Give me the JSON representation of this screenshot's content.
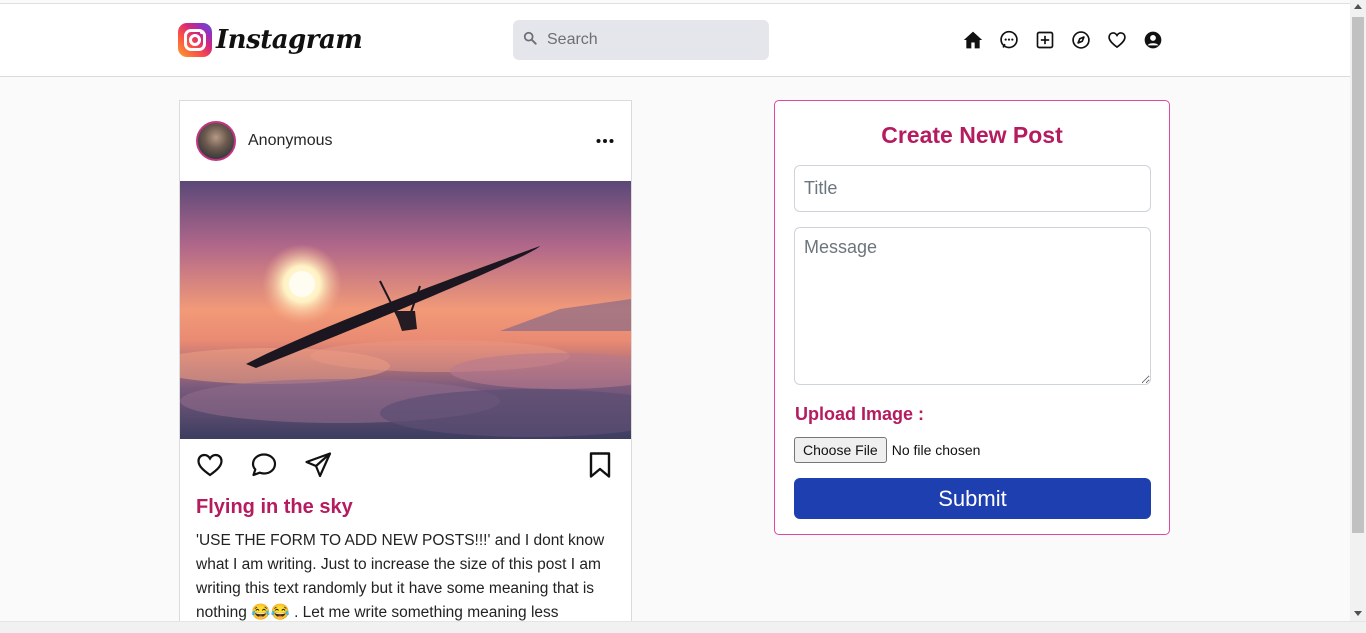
{
  "navbar": {
    "logo_text": "Instagram",
    "search_placeholder": "Search",
    "icons": [
      "home-icon",
      "messenger-icon",
      "new-post-icon",
      "explore-icon",
      "activity-heart-icon",
      "profile-icon"
    ]
  },
  "post": {
    "username": "Anonymous",
    "title": "Flying in the sky",
    "body": "'USE THE FORM TO ADD NEW POSTS!!!' and I dont know what I am writing. Just to increase the size of this post I am writing this text randomly but it have some meaning that is nothing 😂😂 . Let me write something meaning less"
  },
  "form": {
    "heading": "Create New Post",
    "title_placeholder": "Title",
    "message_placeholder": "Message",
    "upload_label": "Upload Image :",
    "choose_file_label": "Choose File",
    "no_file_text": "No file chosen",
    "submit_label": "Submit"
  },
  "colors": {
    "accent": "#b51b5f",
    "submit": "#1e3faf",
    "card_border": "#e0479e"
  }
}
